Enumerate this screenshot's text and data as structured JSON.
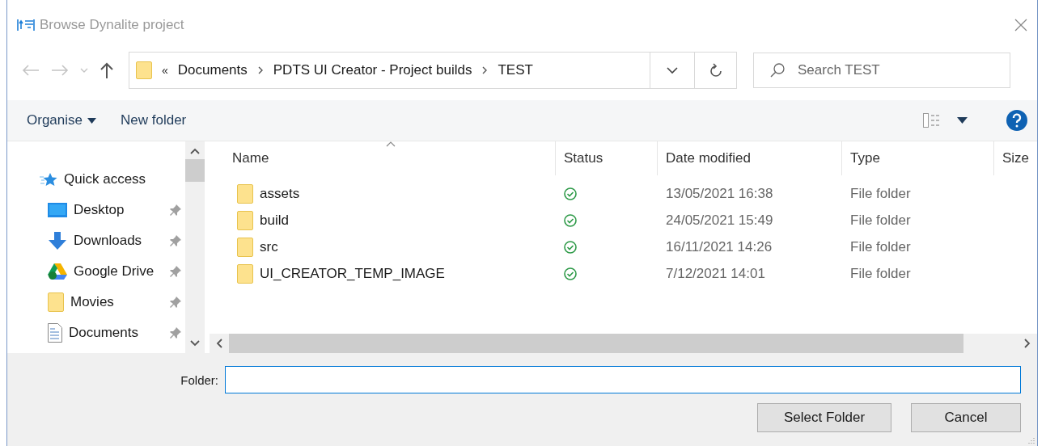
{
  "window": {
    "title": "Browse Dynalite project"
  },
  "address": {
    "overflow": "«",
    "path": [
      "Documents",
      "PDTS UI Creator - Project builds",
      "TEST"
    ]
  },
  "search": {
    "placeholder": "Search TEST"
  },
  "toolbar": {
    "organise": "Organise",
    "new_folder": "New folder"
  },
  "sidebar": {
    "items": [
      {
        "label": "Quick access",
        "kind": "quick",
        "pinned": false
      },
      {
        "label": "Desktop",
        "kind": "desktop",
        "pinned": true
      },
      {
        "label": "Downloads",
        "kind": "downloads",
        "pinned": true
      },
      {
        "label": "Google Drive",
        "kind": "drive",
        "pinned": true
      },
      {
        "label": "Movies",
        "kind": "folder",
        "pinned": true
      },
      {
        "label": "Documents",
        "kind": "document",
        "pinned": true
      }
    ]
  },
  "table": {
    "columns": [
      "Name",
      "Status",
      "Date modified",
      "Type",
      "Size"
    ],
    "rows": [
      {
        "name": "assets",
        "date": "13/05/2021 16:38",
        "type": "File folder"
      },
      {
        "name": "build",
        "date": "24/05/2021 15:49",
        "type": "File folder"
      },
      {
        "name": "src",
        "date": "16/11/2021 14:26",
        "type": "File folder"
      },
      {
        "name": "UI_CREATOR_TEMP_IMAGE",
        "date": "7/12/2021 14:01",
        "type": "File folder"
      }
    ]
  },
  "footer": {
    "folder_label": "Folder:",
    "buttons": [
      "Select Folder",
      "Cancel"
    ]
  }
}
